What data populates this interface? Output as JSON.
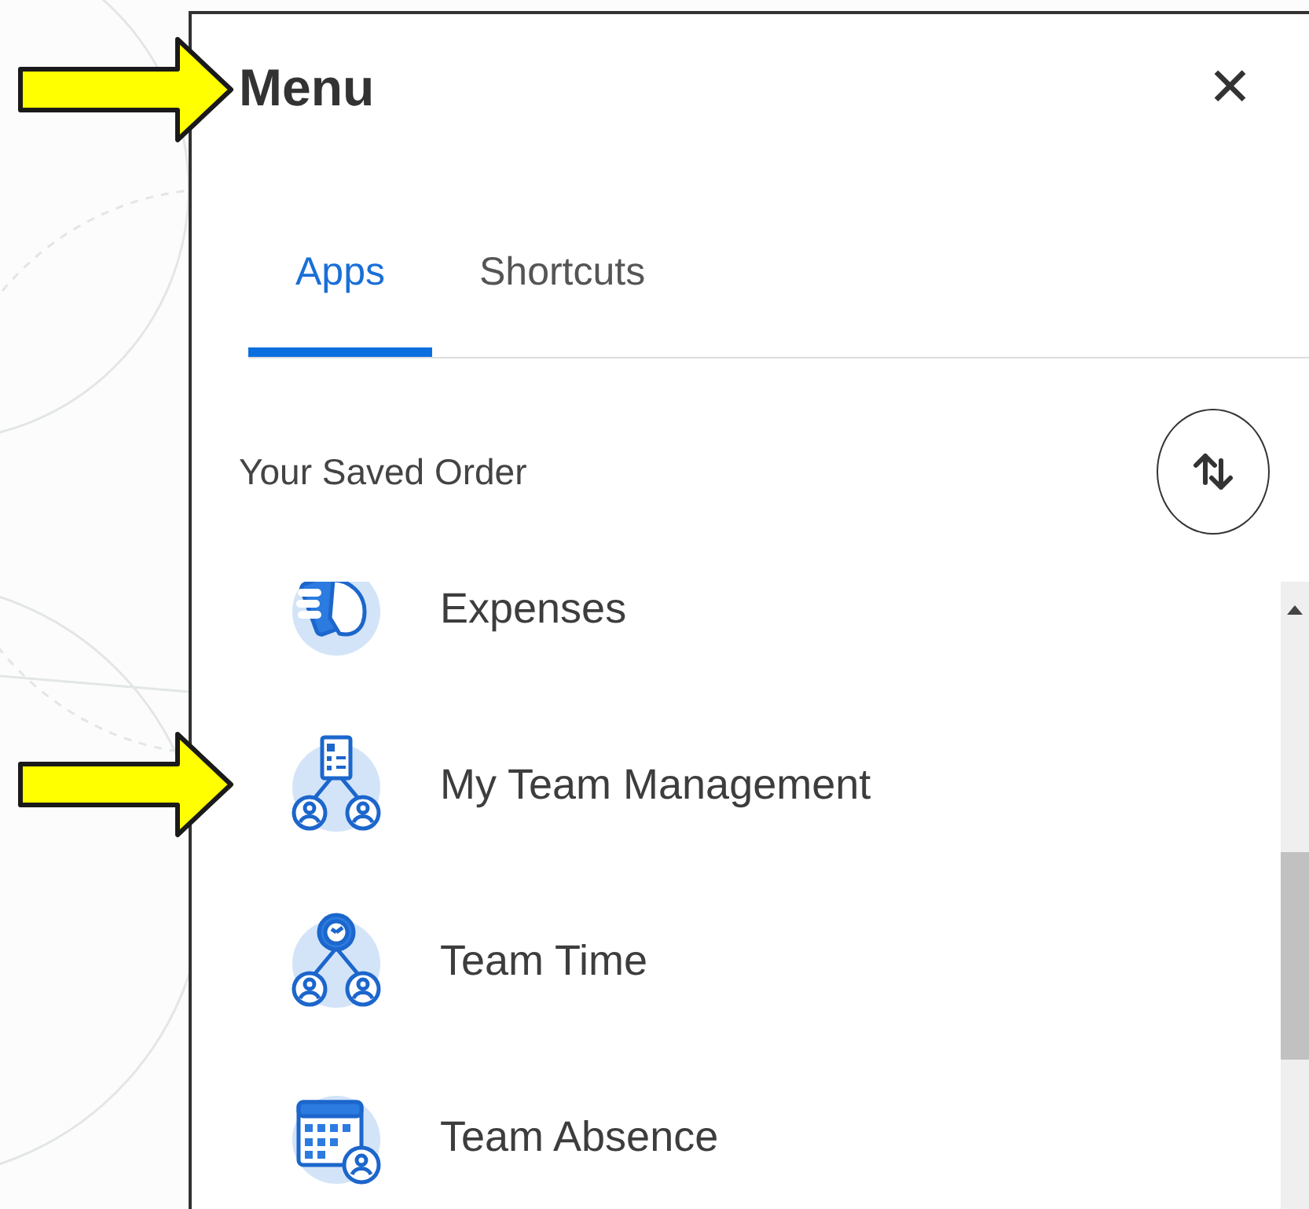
{
  "panel": {
    "title": "Menu",
    "close_glyph": "✕"
  },
  "tabs": [
    {
      "label": "Apps",
      "selected": true
    },
    {
      "label": "Shortcuts",
      "selected": false
    }
  ],
  "section": {
    "title": "Your Saved Order"
  },
  "apps": [
    {
      "kind": "expenses",
      "label": "Expenses"
    },
    {
      "kind": "team-management",
      "label": "My Team Management"
    },
    {
      "kind": "team-time",
      "label": "Team Time"
    },
    {
      "kind": "team-absence",
      "label": "Team Absence"
    }
  ]
}
